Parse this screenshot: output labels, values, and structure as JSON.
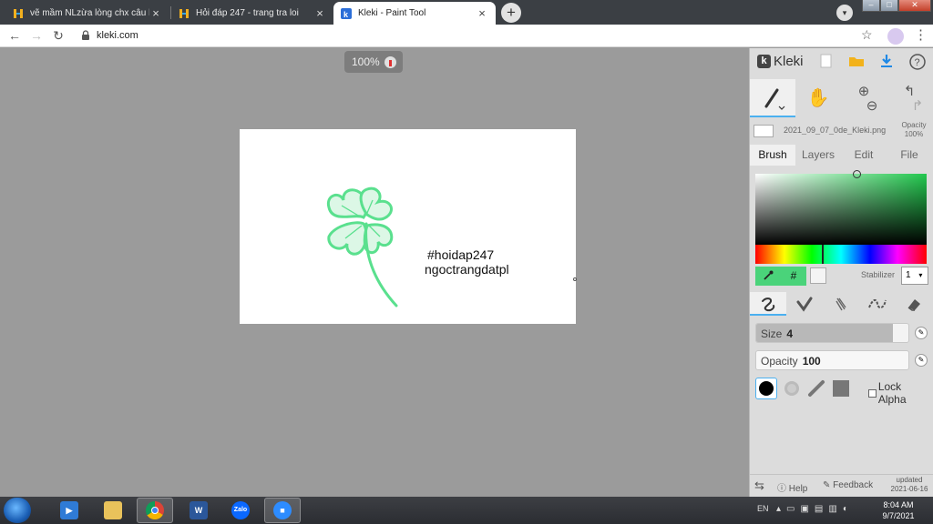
{
  "browser": {
    "tabs": [
      {
        "title": "vẽ mầm NLzừa lòng chx câu hỏi",
        "active": false
      },
      {
        "title": "Hỏi đáp 247 - trang tra loi",
        "active": false
      },
      {
        "title": "Kleki - Paint Tool",
        "active": true
      }
    ],
    "new_tab": "+",
    "url": "kleki.com"
  },
  "workspace": {
    "zoom": "100%",
    "canvas_text_1": "#hoidap247",
    "canvas_text_2": "ngoctrangdatpl"
  },
  "panel": {
    "app_name": "Kleki",
    "file_name": "2021_09_07_0de_Kleki.png",
    "opacity_label": "Opacity",
    "opacity_value": "100%",
    "tabs": [
      "Brush",
      "Layers",
      "Edit",
      "File"
    ],
    "hex_symbol": "#",
    "stabilizer_label": "Stabilizer",
    "stabilizer_value": "1",
    "size_label": "Size",
    "size_value": "4",
    "size_fraction": 0.04,
    "brush_opacity_label": "Opacity",
    "brush_opacity_value": "100",
    "lock_alpha": "Lock Alpha",
    "help": "Help",
    "feedback": "Feedback",
    "updated_label": "updated",
    "updated_date": "2021-06-16",
    "primary_color": "#4ad37a",
    "hue_color": "#22c84e"
  },
  "taskbar": {
    "apps": [
      "start",
      "media-player",
      "file-explorer",
      "chrome",
      "word",
      "zalo",
      "zoom"
    ],
    "language": "EN",
    "time": "8:04 AM",
    "date": "9/7/2021"
  }
}
